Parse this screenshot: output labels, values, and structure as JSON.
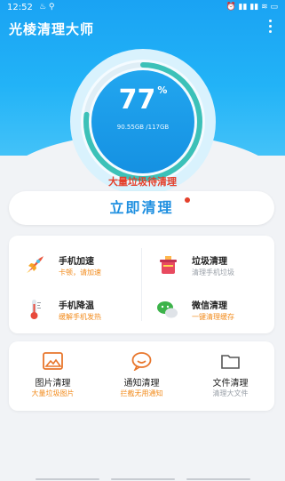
{
  "status": {
    "time": "12:52",
    "left_icons": "♨ ⚲",
    "right_icons": "⏰ ▮▮ ▮▮ ≋ ▭"
  },
  "app": {
    "title": "光棱清理大师"
  },
  "gauge": {
    "percent": "77",
    "percent_sign": "%",
    "level": 0.77,
    "storage": "90.55GB /117GB",
    "color": "#3cc1b8"
  },
  "alert": {
    "text": "大量垃圾待清理"
  },
  "clean_button": {
    "label": "立即清理"
  },
  "features": [
    {
      "name": "手机加速",
      "desc": "卡顿，请加速",
      "icon": "rocket-icon"
    },
    {
      "name": "垃圾清理",
      "desc": "清理手机垃圾",
      "icon": "trash-icon"
    },
    {
      "name": "手机降温",
      "desc": "缓解手机发热",
      "icon": "thermometer-icon"
    },
    {
      "name": "微信清理",
      "desc": "一键清理缓存",
      "icon": "wechat-icon"
    }
  ],
  "tools": [
    {
      "name": "图片清理",
      "desc": "大量垃圾图片",
      "icon": "image-icon"
    },
    {
      "name": "通知清理",
      "desc": "拦截无用通知",
      "icon": "notification-icon"
    },
    {
      "name": "文件清理",
      "desc": "清理大文件",
      "icon": "folder-icon"
    }
  ],
  "colors": {
    "accent": "#1e8fe0",
    "warning": "#e4402b",
    "highlight": "#f28c1e"
  }
}
